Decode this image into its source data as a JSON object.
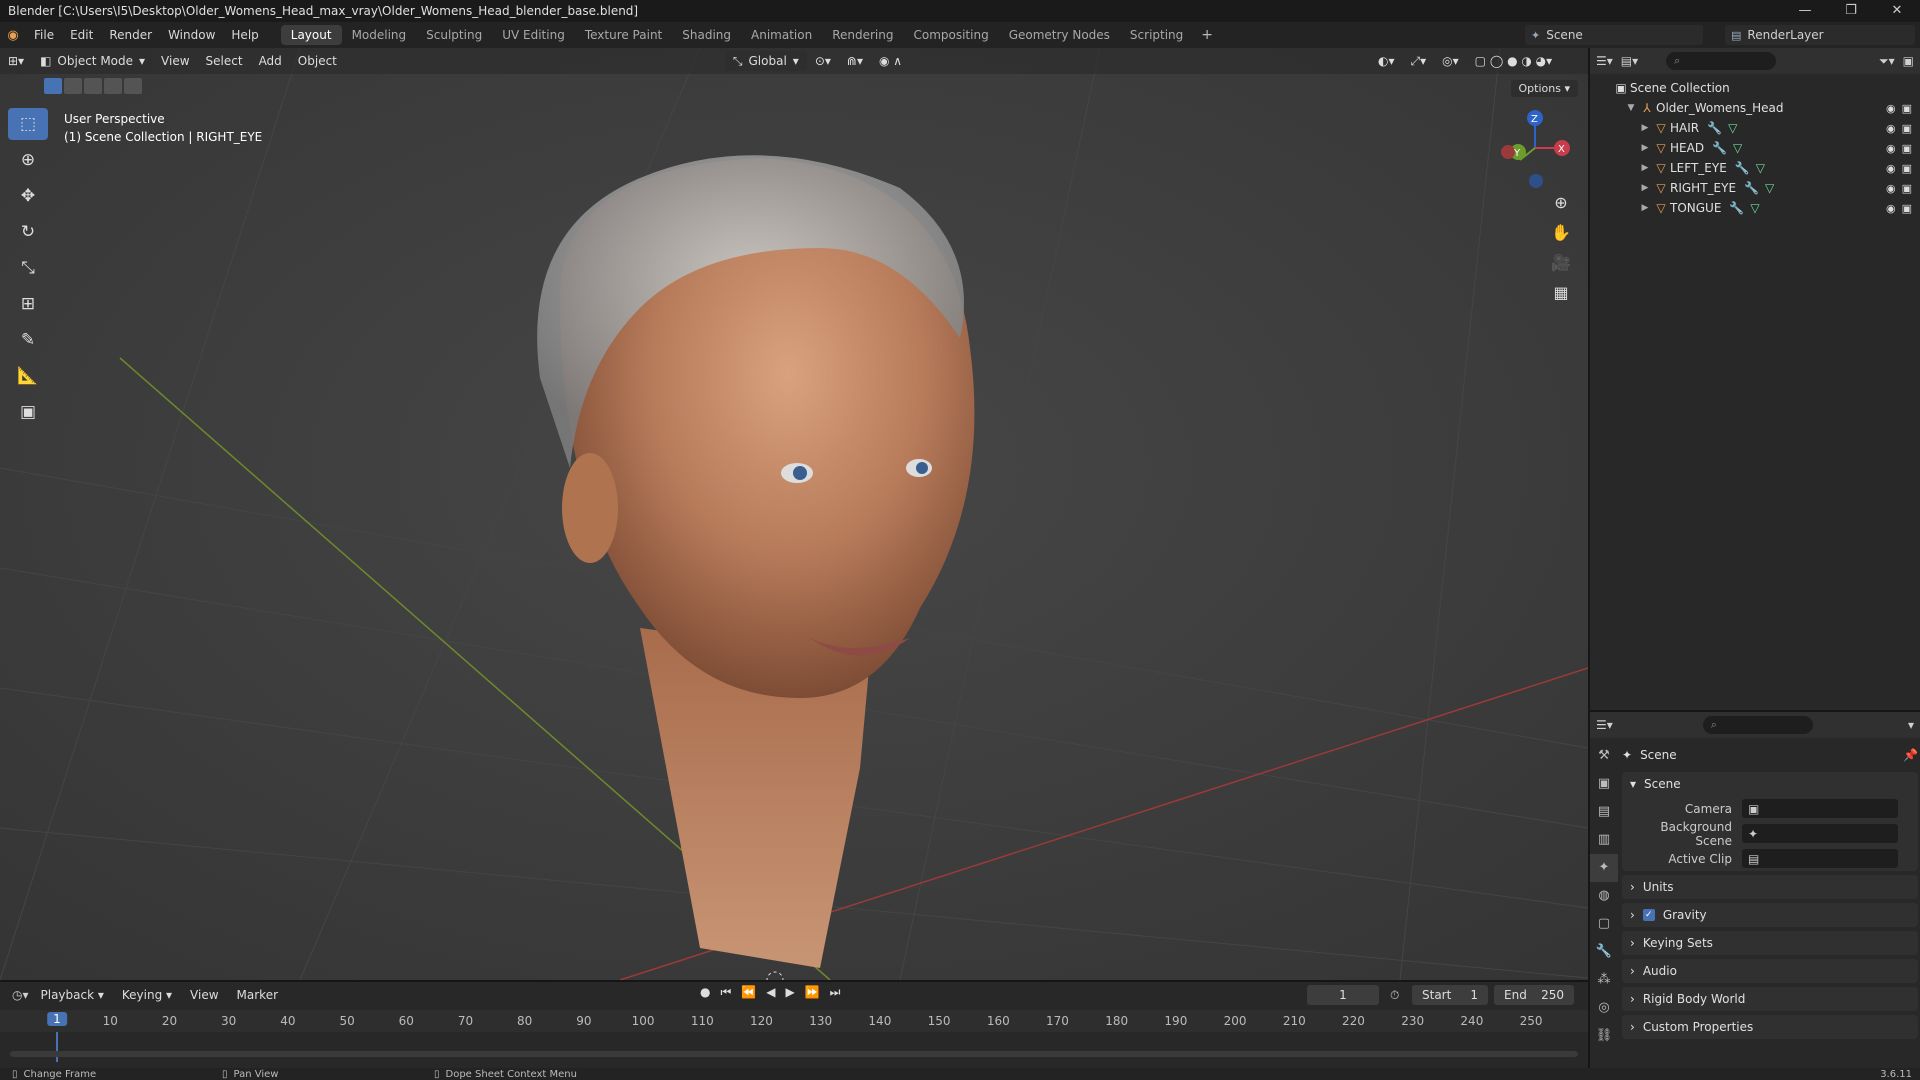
{
  "window": {
    "title": "Blender [C:\\Users\\I5\\Desktop\\Older_Womens_Head_max_vray\\Older_Womens_Head_blender_base.blend]",
    "minimize": "—",
    "maximize": "❐",
    "close": "✕"
  },
  "menu": [
    "File",
    "Edit",
    "Render",
    "Window",
    "Help"
  ],
  "workspaces": [
    "Layout",
    "Modeling",
    "Sculpting",
    "UV Editing",
    "Texture Paint",
    "Shading",
    "Animation",
    "Rendering",
    "Compositing",
    "Geometry Nodes",
    "Scripting"
  ],
  "workspace_add": "+",
  "scene": "Scene",
  "render_layer": "RenderLayer",
  "viewport": {
    "mode": "Object Mode",
    "menus": [
      "View",
      "Select",
      "Add",
      "Object"
    ],
    "orientation": "Global",
    "info_line1": "User Perspective",
    "info_line2": "(1) Scene Collection | RIGHT_EYE",
    "options": "Options",
    "gizmo": {
      "z": "Z",
      "x": "X",
      "y": "Y"
    }
  },
  "outliner": {
    "root": "Scene Collection",
    "collection": "Older_Womens_Head",
    "objects": [
      "HAIR",
      "HEAD",
      "LEFT_EYE",
      "RIGHT_EYE",
      "TONGUE"
    ]
  },
  "properties": {
    "title": "Scene",
    "panel": "Scene",
    "fields": {
      "camera": "Camera",
      "background_scene": "Background Scene",
      "active_clip": "Active Clip"
    },
    "sections": [
      "Units",
      "Gravity",
      "Keying Sets",
      "Audio",
      "Rigid Body World",
      "Custom Properties"
    ],
    "gravity_checked": true
  },
  "timeline": {
    "menus": [
      "Playback",
      "Keying",
      "View",
      "Marker"
    ],
    "current_frame": "1",
    "start_label": "Start",
    "start": "1",
    "end_label": "End",
    "end": "250",
    "ticks": [
      "10",
      "20",
      "30",
      "40",
      "50",
      "60",
      "70",
      "80",
      "90",
      "100",
      "110",
      "120",
      "130",
      "140",
      "150",
      "160",
      "170",
      "180",
      "190",
      "200",
      "210",
      "220",
      "230",
      "240",
      "250"
    ]
  },
  "status": {
    "left": "Change Frame",
    "middle": "Pan View",
    "right": "Dope Sheet Context Menu",
    "version": "3.6.11"
  },
  "colors": {
    "accent": "#4772b3",
    "object": "#e8a050",
    "modifier": "#6fa8dc",
    "mesh": "#6fdc9a"
  }
}
